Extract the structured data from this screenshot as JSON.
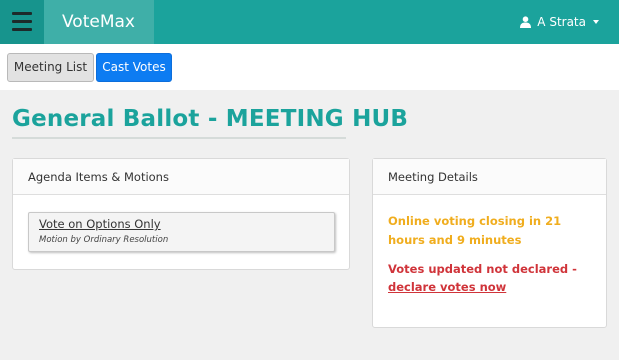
{
  "header": {
    "brand": "VoteMax",
    "user_name": "A Strata"
  },
  "tabs": [
    {
      "label": "Meeting List",
      "active": false
    },
    {
      "label": "Cast Votes",
      "active": true
    }
  ],
  "page": {
    "title": "General Ballot - MEETING HUB"
  },
  "agenda": {
    "heading": "Agenda Items & Motions",
    "items": [
      {
        "title": "Vote on Options Only",
        "subtitle": "Motion by Ordinary Resolution"
      }
    ]
  },
  "details": {
    "heading": "Meeting Details",
    "closing_text": "Online voting closing in 21 hours and 9 minutes",
    "votes_prefix": "Votes updated not declared - ",
    "declare_link": "declare votes now"
  },
  "colors": {
    "brand": "#1ba39c",
    "primary_button": "#0d7cf2",
    "warning": "#f0ad1e",
    "danger": "#d0343a"
  },
  "icons": {
    "menu": "hamburger-icon",
    "user": "user-icon",
    "dropdown": "caret-down-icon"
  }
}
